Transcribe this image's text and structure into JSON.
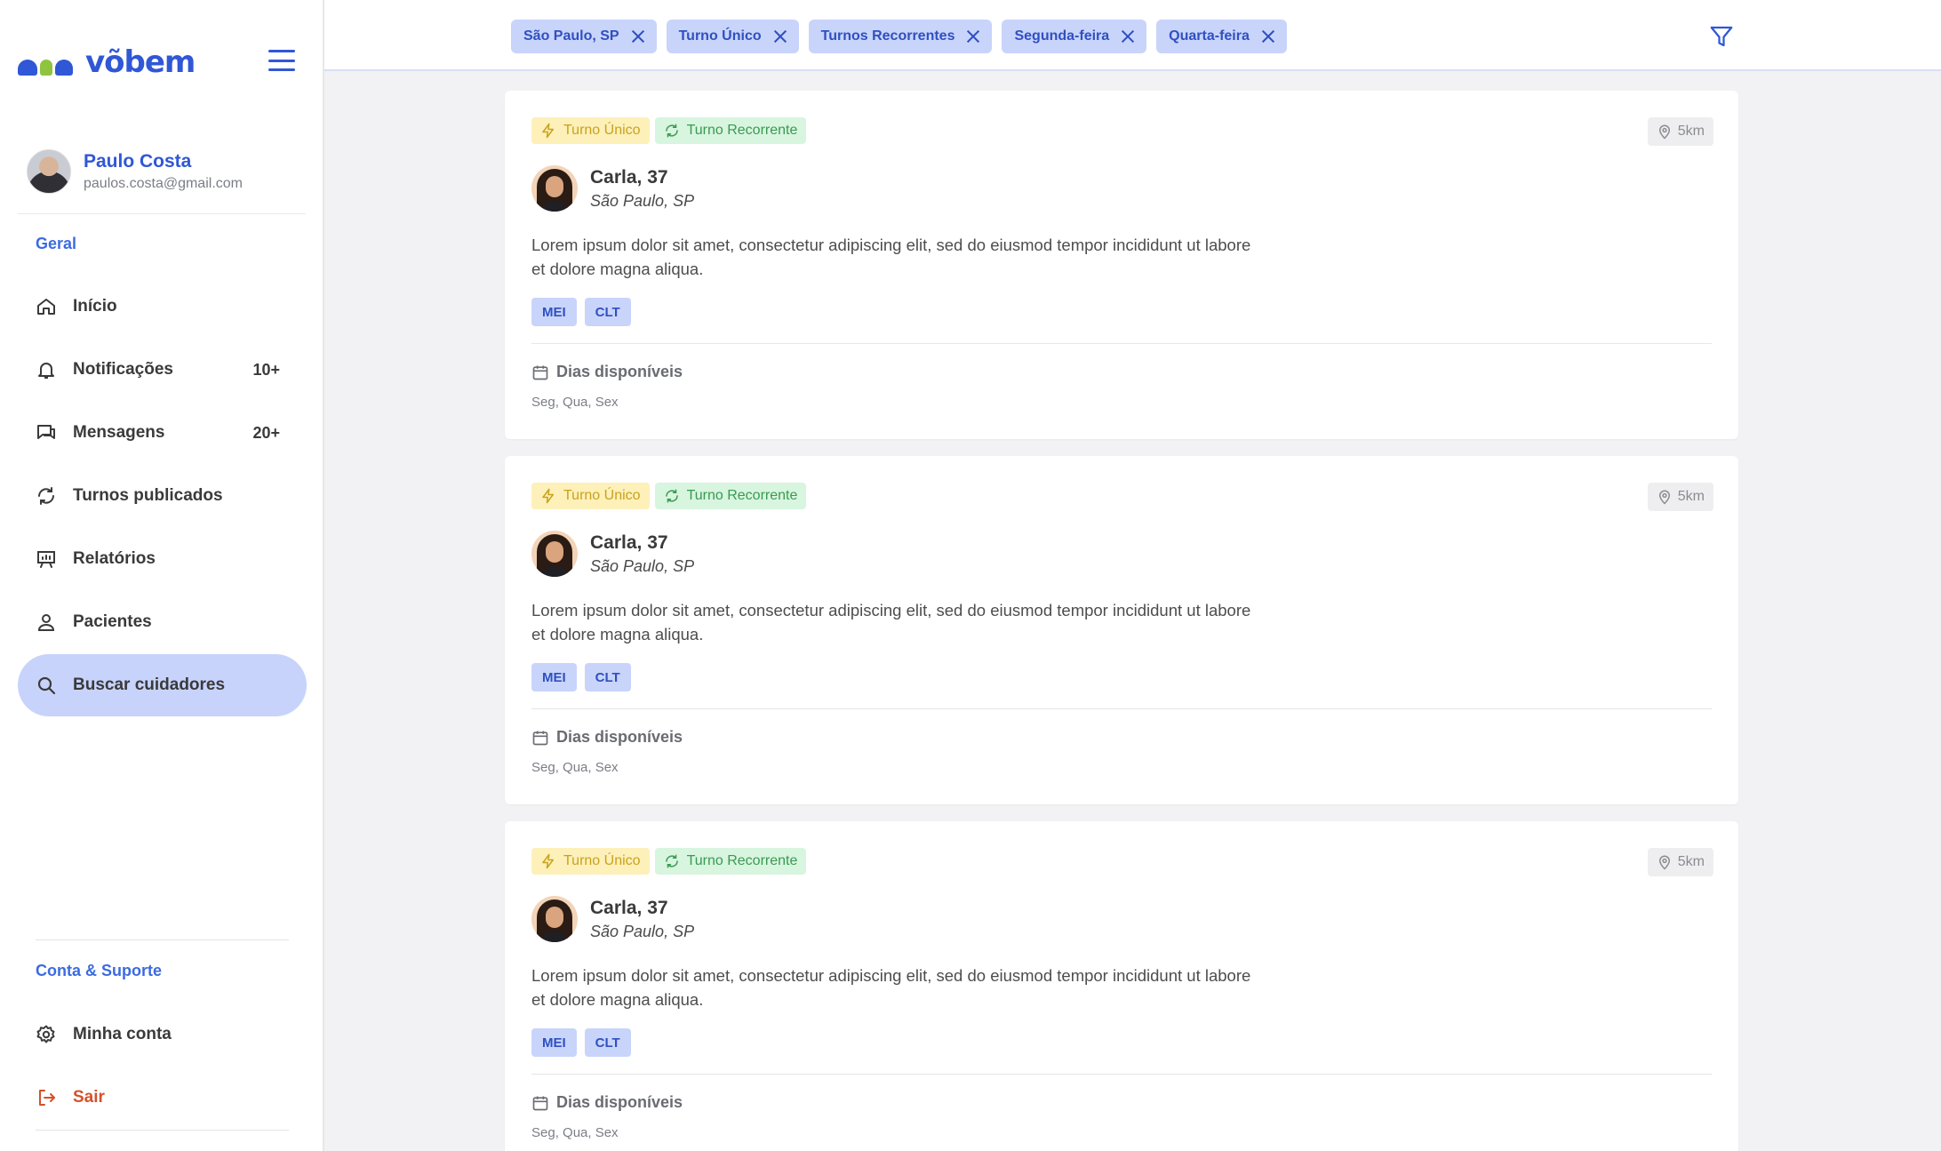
{
  "brand": {
    "name": "võbem"
  },
  "user": {
    "name": "Paulo Costa",
    "email": "paulos.costa@gmail.com"
  },
  "sidebar": {
    "section_general": "Geral",
    "items": [
      {
        "label": "Início",
        "icon": "home-icon",
        "count": ""
      },
      {
        "label": "Notificações",
        "icon": "bell-icon",
        "count": "10+"
      },
      {
        "label": "Mensagens",
        "icon": "chat-icon",
        "count": "20+"
      },
      {
        "label": "Turnos publicados",
        "icon": "refresh-icon",
        "count": ""
      },
      {
        "label": "Relatórios",
        "icon": "presentation-chart-icon",
        "count": ""
      },
      {
        "label": "Pacientes",
        "icon": "users-icon",
        "count": ""
      },
      {
        "label": "Buscar cuidadores",
        "icon": "search-icon",
        "count": "",
        "active": true
      }
    ],
    "section_account": "Conta & Suporte",
    "account_items": [
      {
        "label": "Minha conta",
        "icon": "gear-icon"
      },
      {
        "label": "Sair",
        "icon": "logout-icon"
      }
    ]
  },
  "filters": [
    {
      "label": "São Paulo, SP"
    },
    {
      "label": "Turno Único"
    },
    {
      "label": "Turnos Recorrentes"
    },
    {
      "label": "Segunda-feira"
    },
    {
      "label": "Quarta-feira"
    }
  ],
  "colors": {
    "accent": "#2f57d6",
    "chip_bg": "#c9d4fb",
    "badge_yellow": "#fdf0b9",
    "badge_green": "#d8f5df",
    "logout": "#d4512a"
  },
  "cards": [
    {
      "badge_single": "Turno Único",
      "badge_recurring": "Turno Recorrente",
      "distance": "5km",
      "name": "Carla, 37",
      "city": "São Paulo, SP",
      "description": "Lorem ipsum dolor sit amet, consectetur adipiscing elit, sed do eiusmod tempor incididunt ut labore et dolore magna aliqua.",
      "tags": [
        "MEI",
        "CLT"
      ],
      "days_title": "Dias disponíveis",
      "days": "Seg, Qua, Sex"
    },
    {
      "badge_single": "Turno Único",
      "badge_recurring": "Turno Recorrente",
      "distance": "5km",
      "name": "Carla, 37",
      "city": "São Paulo, SP",
      "description": "Lorem ipsum dolor sit amet, consectetur adipiscing elit, sed do eiusmod tempor incididunt ut labore et dolore magna aliqua.",
      "tags": [
        "MEI",
        "CLT"
      ],
      "days_title": "Dias disponíveis",
      "days": "Seg, Qua, Sex"
    },
    {
      "badge_single": "Turno Único",
      "badge_recurring": "Turno Recorrente",
      "distance": "5km",
      "name": "Carla, 37",
      "city": "São Paulo, SP",
      "description": "Lorem ipsum dolor sit amet, consectetur adipiscing elit, sed do eiusmod tempor incididunt ut labore et dolore magna aliqua.",
      "tags": [
        "MEI",
        "CLT"
      ],
      "days_title": "Dias disponíveis",
      "days": "Seg, Qua, Sex"
    }
  ]
}
